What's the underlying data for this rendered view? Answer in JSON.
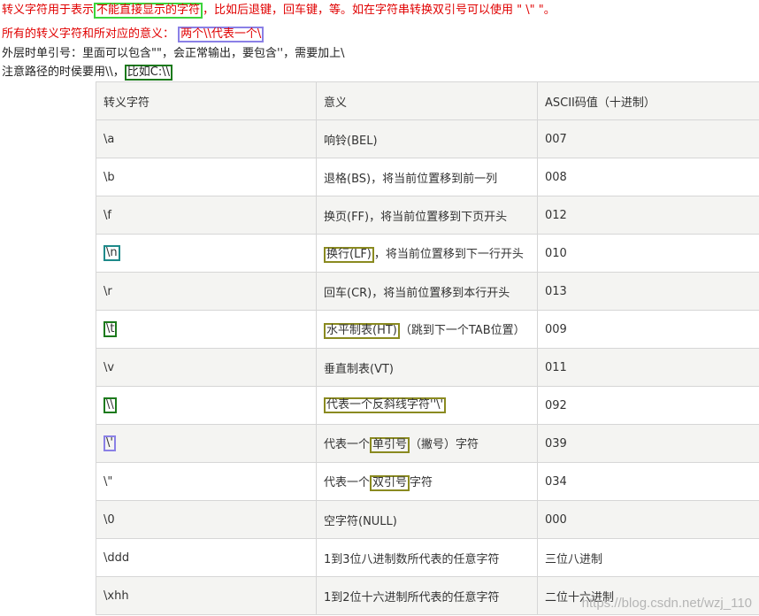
{
  "intro": {
    "line1_a": "转义字符用于表示",
    "line1_box": "不能直接显示的字符",
    "line1_b": "，比如后退键，回车键，等。如在字符串转换双引号可以使用 \" \\\" \"。",
    "line2_a": "所有的转义字符和所对应的意义：",
    "line2_box": "两个\\\\代表一个\\",
    "line3": "外层时单引号：里面可以包含\"\"，会正常输出，要包含''，需要加上\\",
    "line4_a": "注意路径的时侯要用\\\\，",
    "line4_box": "比如C:\\\\"
  },
  "table": {
    "headers": [
      "转义字符",
      "意义",
      "ASCII码值（十进制）"
    ],
    "rows": [
      {
        "esc": "\\a",
        "meaning_a": "响铃(BEL)",
        "meaning_box": "",
        "meaning_b": "",
        "ascii": "007"
      },
      {
        "esc": "\\b",
        "meaning_a": "退格(BS)，将当前位置移到前一列",
        "meaning_box": "",
        "meaning_b": "",
        "ascii": "008"
      },
      {
        "esc": "\\f",
        "meaning_a": "换页(FF)，将当前位置移到下页开头",
        "meaning_box": "",
        "meaning_b": "",
        "ascii": "012"
      },
      {
        "esc": "\\n",
        "meaning_a": "",
        "meaning_box": "换行(LF)",
        "meaning_b": "，将当前位置移到下一行开头",
        "ascii": "010"
      },
      {
        "esc": "\\r",
        "meaning_a": "回车(CR)，将当前位置移到本行开头",
        "meaning_box": "",
        "meaning_b": "",
        "ascii": "013"
      },
      {
        "esc": "\\t",
        "meaning_a": "",
        "meaning_box": "水平制表(HT)",
        "meaning_b": "（跳到下一个TAB位置）",
        "ascii": "009"
      },
      {
        "esc": "\\v",
        "meaning_a": "垂直制表(VT)",
        "meaning_box": "",
        "meaning_b": "",
        "ascii": "011"
      },
      {
        "esc": "\\\\",
        "meaning_a": "",
        "meaning_box": "代表一个反斜线字符''\\'",
        "meaning_b": "",
        "ascii": "092"
      },
      {
        "esc": "\\'",
        "meaning_a": "代表一个",
        "meaning_box": "单引号",
        "meaning_b": "（撇号）字符",
        "ascii": "039"
      },
      {
        "esc": "\\\"",
        "meaning_a": "代表一个",
        "meaning_box": "双引号",
        "meaning_b": "字符",
        "ascii": "034"
      },
      {
        "esc": "\\0",
        "meaning_a": "空字符(NULL)",
        "meaning_box": "",
        "meaning_b": "",
        "ascii": "000"
      },
      {
        "esc": "\\ddd",
        "meaning_a": "1到3位八进制数所代表的任意字符",
        "meaning_box": "",
        "meaning_b": "",
        "ascii": "三位八进制"
      },
      {
        "esc": "\\xhh",
        "meaning_a": "1到2位十六进制所代表的任意字符",
        "meaning_box": "",
        "meaning_b": "",
        "ascii": "二位十六进制"
      }
    ]
  },
  "watermark": "https://blog.csdn.net/wzj_110",
  "colors": {
    "intro_red": "#e00000",
    "box_green": "#3bd43b",
    "box_purple": "#8a80e6",
    "box_dark_green": "#1c7a1c",
    "box_olive": "#8a8a20",
    "box_teal": "#1e8a8a"
  }
}
